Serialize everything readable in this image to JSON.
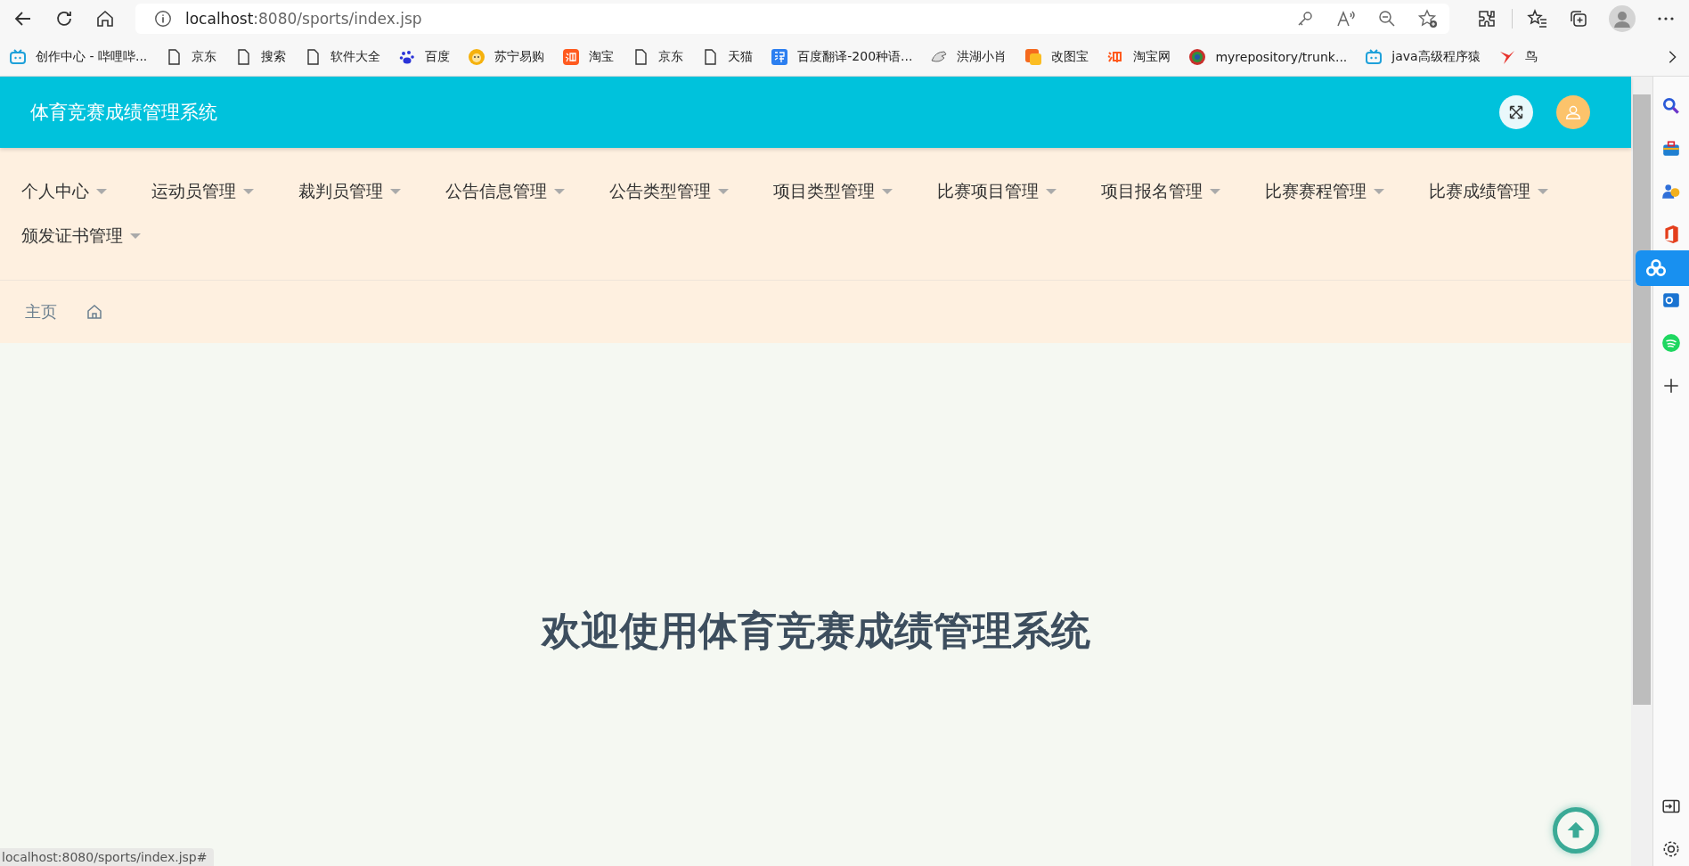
{
  "browser": {
    "url_host": "localhost",
    "url_rest": ":8080/sports/index.jsp"
  },
  "bookmarks": [
    {
      "label": "创作中心 - 哔哩哔...",
      "kind": "tv"
    },
    {
      "label": "京东",
      "kind": "page"
    },
    {
      "label": "搜索",
      "kind": "page"
    },
    {
      "label": "软件大全",
      "kind": "page"
    },
    {
      "label": "百度",
      "kind": "paw"
    },
    {
      "label": "苏宁易购",
      "kind": "lion"
    },
    {
      "label": "淘宝",
      "kind": "tao"
    },
    {
      "label": "京东",
      "kind": "page"
    },
    {
      "label": "天猫",
      "kind": "page"
    },
    {
      "label": "百度翻译-200种语...",
      "kind": "translate"
    },
    {
      "label": "洪湖小肖",
      "kind": "bird-grey"
    },
    {
      "label": "改图宝",
      "kind": "orange-square"
    },
    {
      "label": "淘宝网",
      "kind": "tao-plain"
    },
    {
      "label": "myrepository/trunk...",
      "kind": "ring"
    },
    {
      "label": "java高级程序猿",
      "kind": "tv"
    },
    {
      "label": "鸟",
      "kind": "bird-red"
    }
  ],
  "header": {
    "title": "体育竞赛成绩管理系统"
  },
  "nav": [
    {
      "label": "个人中心"
    },
    {
      "label": "运动员管理"
    },
    {
      "label": "裁判员管理"
    },
    {
      "label": "公告信息管理"
    },
    {
      "label": "公告类型管理"
    },
    {
      "label": "项目类型管理"
    },
    {
      "label": "比赛项目管理"
    },
    {
      "label": "项目报名管理"
    },
    {
      "label": "比赛赛程管理"
    },
    {
      "label": "比赛成绩管理"
    },
    {
      "label": "颁发证书管理"
    }
  ],
  "breadcrumb": {
    "label": "主页"
  },
  "welcome": "欢迎使用体育竞赛成绩管理系统",
  "status_url": "localhost:8080/sports/index.jsp#"
}
